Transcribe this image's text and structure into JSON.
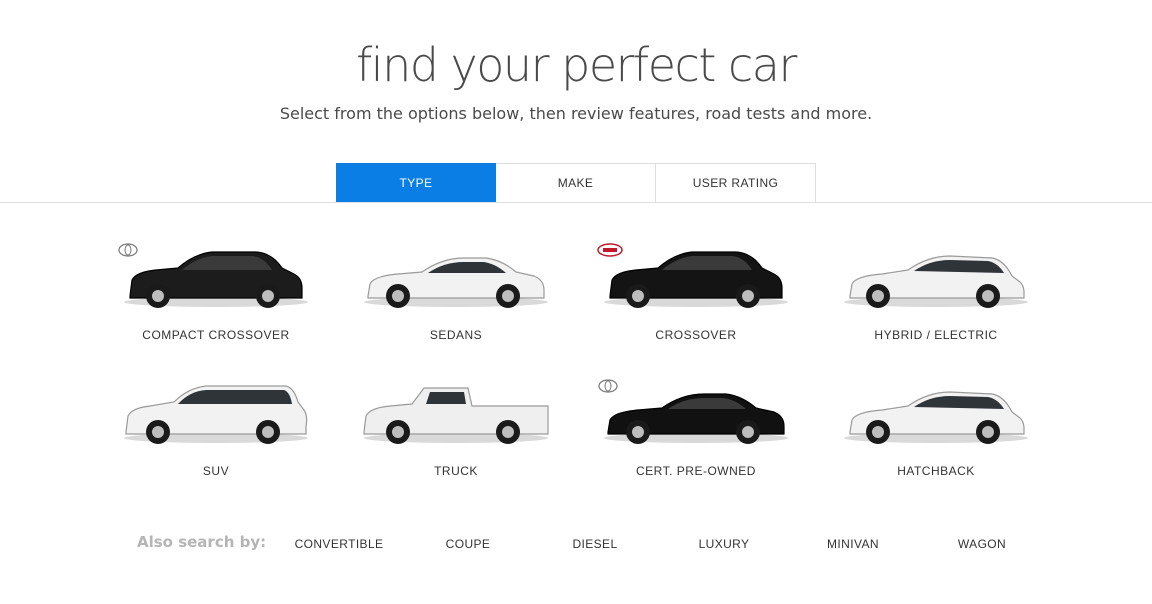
{
  "header": {
    "title": "find your perfect car",
    "subtitle": "Select from the options below, then review features, road tests and more."
  },
  "tabs": [
    {
      "label": "TYPE",
      "active": true
    },
    {
      "label": "MAKE",
      "active": false
    },
    {
      "label": "USER RATING",
      "active": false
    }
  ],
  "types": [
    {
      "label": "COMPACT CROSSOVER",
      "shape": "crossover",
      "color": "#1c1c1c",
      "badge": "toyota"
    },
    {
      "label": "SEDANS",
      "shape": "sedan",
      "color": "#f2f2f2",
      "badge": ""
    },
    {
      "label": "CROSSOVER",
      "shape": "crossover",
      "color": "#141414",
      "badge": "kia"
    },
    {
      "label": "HYBRID / ELECTRIC",
      "shape": "hatch",
      "color": "#f2f2f2",
      "badge": ""
    },
    {
      "label": "SUV",
      "shape": "suv",
      "color": "#f2f2f2",
      "badge": ""
    },
    {
      "label": "TRUCK",
      "shape": "truck",
      "color": "#efefef",
      "badge": ""
    },
    {
      "label": "CERT. PRE-OWNED",
      "shape": "sedan",
      "color": "#111111",
      "badge": "toyota"
    },
    {
      "label": "HATCHBACK",
      "shape": "hatch",
      "color": "#f2f2f2",
      "badge": ""
    }
  ],
  "also_search": {
    "label": "Also search by:",
    "items": [
      "CONVERTIBLE",
      "COUPE",
      "DIESEL",
      "LUXURY",
      "MINIVAN",
      "WAGON"
    ]
  },
  "colors": {
    "accent": "#0a7ee5",
    "text": "#333333",
    "muted": "#b5b5b5"
  }
}
